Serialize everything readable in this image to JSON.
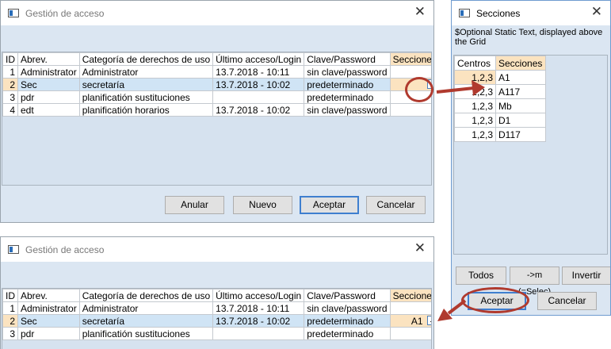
{
  "top_window": {
    "title": "Gestión de acceso",
    "columns": [
      "ID",
      "Abrev.",
      "Categoría de derechos de uso",
      "Último acceso/Login",
      "Clave/Password",
      "Secciones"
    ],
    "rows": [
      {
        "id": "1",
        "abrev": "Administrator",
        "categoria": "Administrator",
        "ultimo": "13.7.2018 - 10:11",
        "clave": "sin clave/password",
        "secciones": ""
      },
      {
        "id": "2",
        "abrev": "Sec",
        "categoria": "secretaría",
        "ultimo": "13.7.2018 - 10:02",
        "clave": "predeterminado",
        "secciones": ""
      },
      {
        "id": "3",
        "abrev": "pdr",
        "categoria": "planificatión sustituciones",
        "ultimo": "",
        "clave": "predeterminado",
        "secciones": ""
      },
      {
        "id": "4",
        "abrev": "edt",
        "categoria": "planificatión horarios",
        "ultimo": "13.7.2018 - 10:02",
        "clave": "sin clave/password",
        "secciones": ""
      }
    ],
    "buttons": {
      "anular": "Anular",
      "nuevo": "Nuevo",
      "aceptar": "Aceptar",
      "cancelar": "Cancelar"
    },
    "ellipsis": "..."
  },
  "bottom_window": {
    "title": "Gestión de acceso",
    "columns": [
      "ID",
      "Abrev.",
      "Categoría de derechos de uso",
      "Último acceso/Login",
      "Clave/Password",
      "Secciones"
    ],
    "rows": [
      {
        "id": "1",
        "abrev": "Administrator",
        "categoria": "Administrator",
        "ultimo": "13.7.2018 - 10:11",
        "clave": "sin clave/password",
        "secciones": ""
      },
      {
        "id": "2",
        "abrev": "Sec",
        "categoria": "secretaría",
        "ultimo": "13.7.2018 - 10:02",
        "clave": "predeterminado",
        "secciones": "A1"
      },
      {
        "id": "3",
        "abrev": "pdr",
        "categoria": "planificatión sustituciones",
        "ultimo": "",
        "clave": "predeterminado",
        "secciones": ""
      }
    ],
    "ellipsis": "..."
  },
  "secciones_window": {
    "title": "Secciones",
    "static_text": "$Optional Static Text, displayed above the Grid",
    "columns": [
      "Centros",
      "Secciones"
    ],
    "rows": [
      {
        "centros": "1,2,3",
        "secciones": "A1"
      },
      {
        "centros": "1,2,3",
        "secciones": "A117"
      },
      {
        "centros": "1,2,3",
        "secciones": "Mb"
      },
      {
        "centros": "1,2,3",
        "secciones": "D1"
      },
      {
        "centros": "1,2,3",
        "secciones": "D117"
      }
    ],
    "buttons": {
      "todos": "Todos",
      "selec": "->m (=Selec)",
      "invertir": "Invertir",
      "aceptar": "Aceptar",
      "cancelar": "Cancelar"
    }
  },
  "colors": {
    "window_bg": "#dbe6f2",
    "selected_row": "#d0e4f5",
    "highlight_cell": "#fbe3c0",
    "annotation_red": "#b03a2e",
    "default_button_border": "#3f7fcf"
  }
}
